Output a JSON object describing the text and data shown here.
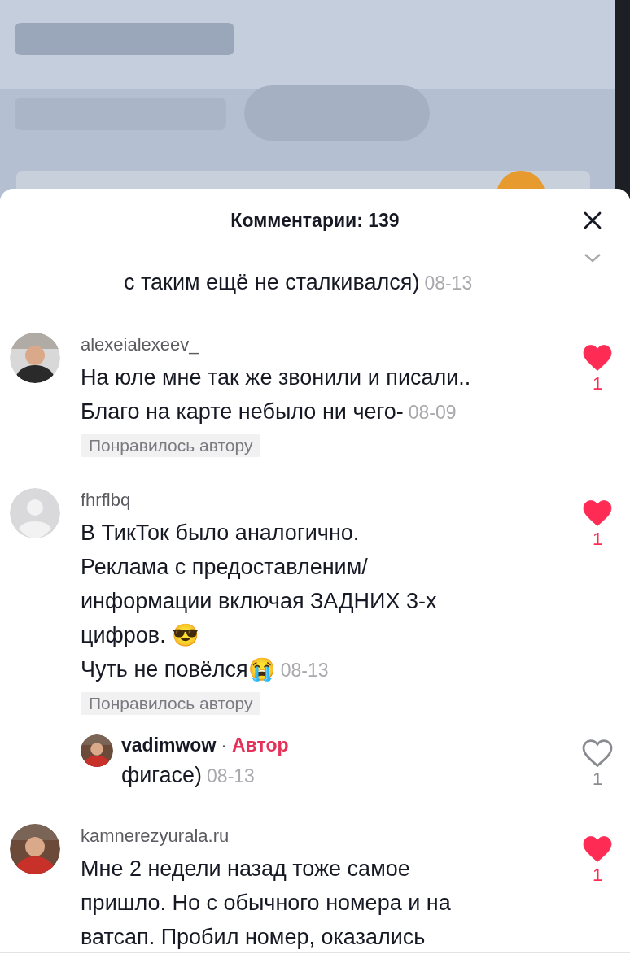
{
  "sheet": {
    "title": "Комментарии: 139"
  },
  "comments": [
    {
      "kind": "partial",
      "text": "с таким ещё не сталкивался)",
      "date": "08-13",
      "collapsed": false
    },
    {
      "kind": "comment",
      "username": "alexeialexeev_",
      "text": "На юле мне так же звонили и писали..\nБлаго на карте небыло ни чего-",
      "date": "08-09",
      "liked": true,
      "likes": "1",
      "badge": "Понравилось автору"
    },
    {
      "kind": "comment",
      "avatar": {
        "kind": "default"
      },
      "username": "fhrflbq",
      "text": "В ТикТок было аналогично.\nРеклама с предоставленим/\nинформации включая ЗАДНИХ 3-х\nцифров. 😎\nЧуть не повёлся😭",
      "date": "08-13",
      "liked": true,
      "likes": "1",
      "badge": "Понравилось автору",
      "replies": [
        {
          "username": "vadimwow",
          "separator": "·",
          "role": "Автор",
          "text": "фигасе)",
          "date": "08-13",
          "liked": false,
          "likes": "1"
        }
      ]
    },
    {
      "kind": "comment",
      "username": "kamnerezyurala.ru",
      "text": "Мне 2 недели назад тоже самое\nпришло. Но с обычного номера и на\nватсап. Пробил номер, оказались",
      "liked": true,
      "likes": "1"
    }
  ]
}
